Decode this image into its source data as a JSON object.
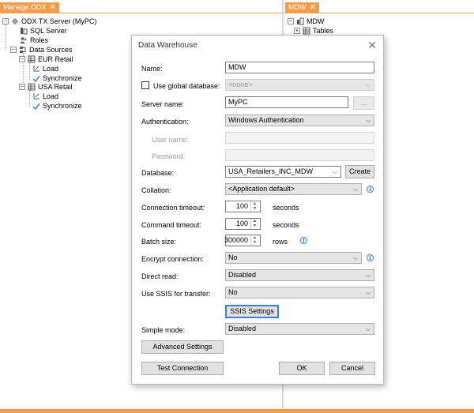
{
  "left_panel": {
    "tab_label": "Manage ODX",
    "tree": {
      "server": "ODX TX Server (MyPC)",
      "sql_server": "SQL Server",
      "roles": "Roles",
      "data_sources": "Data Sources",
      "eur_retail": "EUR Retail",
      "eur_load": "Load",
      "eur_sync": "Synchronize",
      "usa_retail": "USA Retail",
      "usa_load": "Load",
      "usa_sync": "Synchronize"
    }
  },
  "right_panel": {
    "tab_label": "MDW",
    "tree": {
      "root": "MDW",
      "tables": "Tables"
    }
  },
  "dialog": {
    "title": "Data Warehouse",
    "name_label": "Name:",
    "name_value": "MDW",
    "use_global_label": "Use global database:",
    "global_db_value": "<none>",
    "server_name_label": "Server name:",
    "server_name_value": "MyPC",
    "browse_label": "...",
    "auth_label": "Authentication:",
    "auth_value": "Windows Authentication",
    "user_name_label": "User name:",
    "password_label": "Password:",
    "database_label": "Database:",
    "database_value": "USA_Retailers_INC_MDW",
    "create_label": "Create",
    "collation_label": "Collation:",
    "collation_value": "<Application default>",
    "conn_timeout_label": "Connection timeout:",
    "conn_timeout_value": "100",
    "conn_timeout_unit": "seconds",
    "cmd_timeout_label": "Command timeout:",
    "cmd_timeout_value": "100",
    "cmd_timeout_unit": "seconds",
    "batch_size_label": "Batch size:",
    "batch_size_value": "300000",
    "batch_size_unit": "rows",
    "encrypt_label": "Encrypt connection:",
    "encrypt_value": "No",
    "direct_read_label": "Direct read:",
    "direct_read_value": "Disabled",
    "ssis_label": "Use SSIS for transfer:",
    "ssis_value": "No",
    "ssis_settings_label": "SSIS Settings",
    "simple_mode_label": "Simple mode:",
    "simple_mode_value": "Disabled",
    "advanced_label": "Advanced Settings",
    "test_label": "Test Connection",
    "ok_label": "OK",
    "cancel_label": "Cancel"
  },
  "colors": {
    "tab_accent": "#f39c4a",
    "focus_blue": "#3c7fd8",
    "info_blue": "#2c7be5"
  }
}
